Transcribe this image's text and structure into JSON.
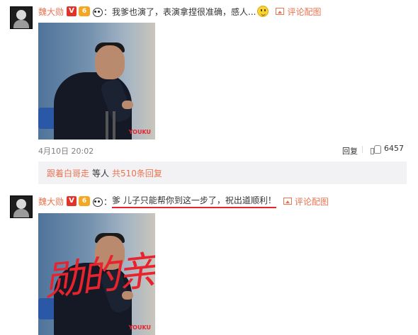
{
  "comments": [
    {
      "username": "魏大勋",
      "badge_v": "V",
      "badge_level": "6",
      "colon": "：",
      "text": "我爹也演了，表演拿捏很准确，感人...",
      "img_link": "评论配图",
      "photo_watermark": "YOUKU",
      "date": "4月10日 20:02",
      "reply": "回复",
      "likes": "6457",
      "sub_replies": {
        "who": "跟着白哥走",
        "etc": "等人",
        "more": "共510条回复"
      }
    },
    {
      "username": "魏大勋",
      "badge_v": "V",
      "badge_level": "6",
      "colon": "：",
      "text": "爹 儿子只能帮你到这一步了，祝出道顺利！",
      "img_link": "评论配图",
      "photo_overlay": "勋的亲",
      "photo_watermark": "YOUKU"
    }
  ],
  "icons": {
    "image": "image-icon",
    "like": "thumbs-up-icon",
    "emoji": "smile-emoji-icon",
    "panda": "panda-badge-icon"
  },
  "colors": {
    "link": "#eb7350",
    "badge": "#e0342b",
    "underline": "#e8232d",
    "subbox_bg": "#f2f2f5"
  }
}
